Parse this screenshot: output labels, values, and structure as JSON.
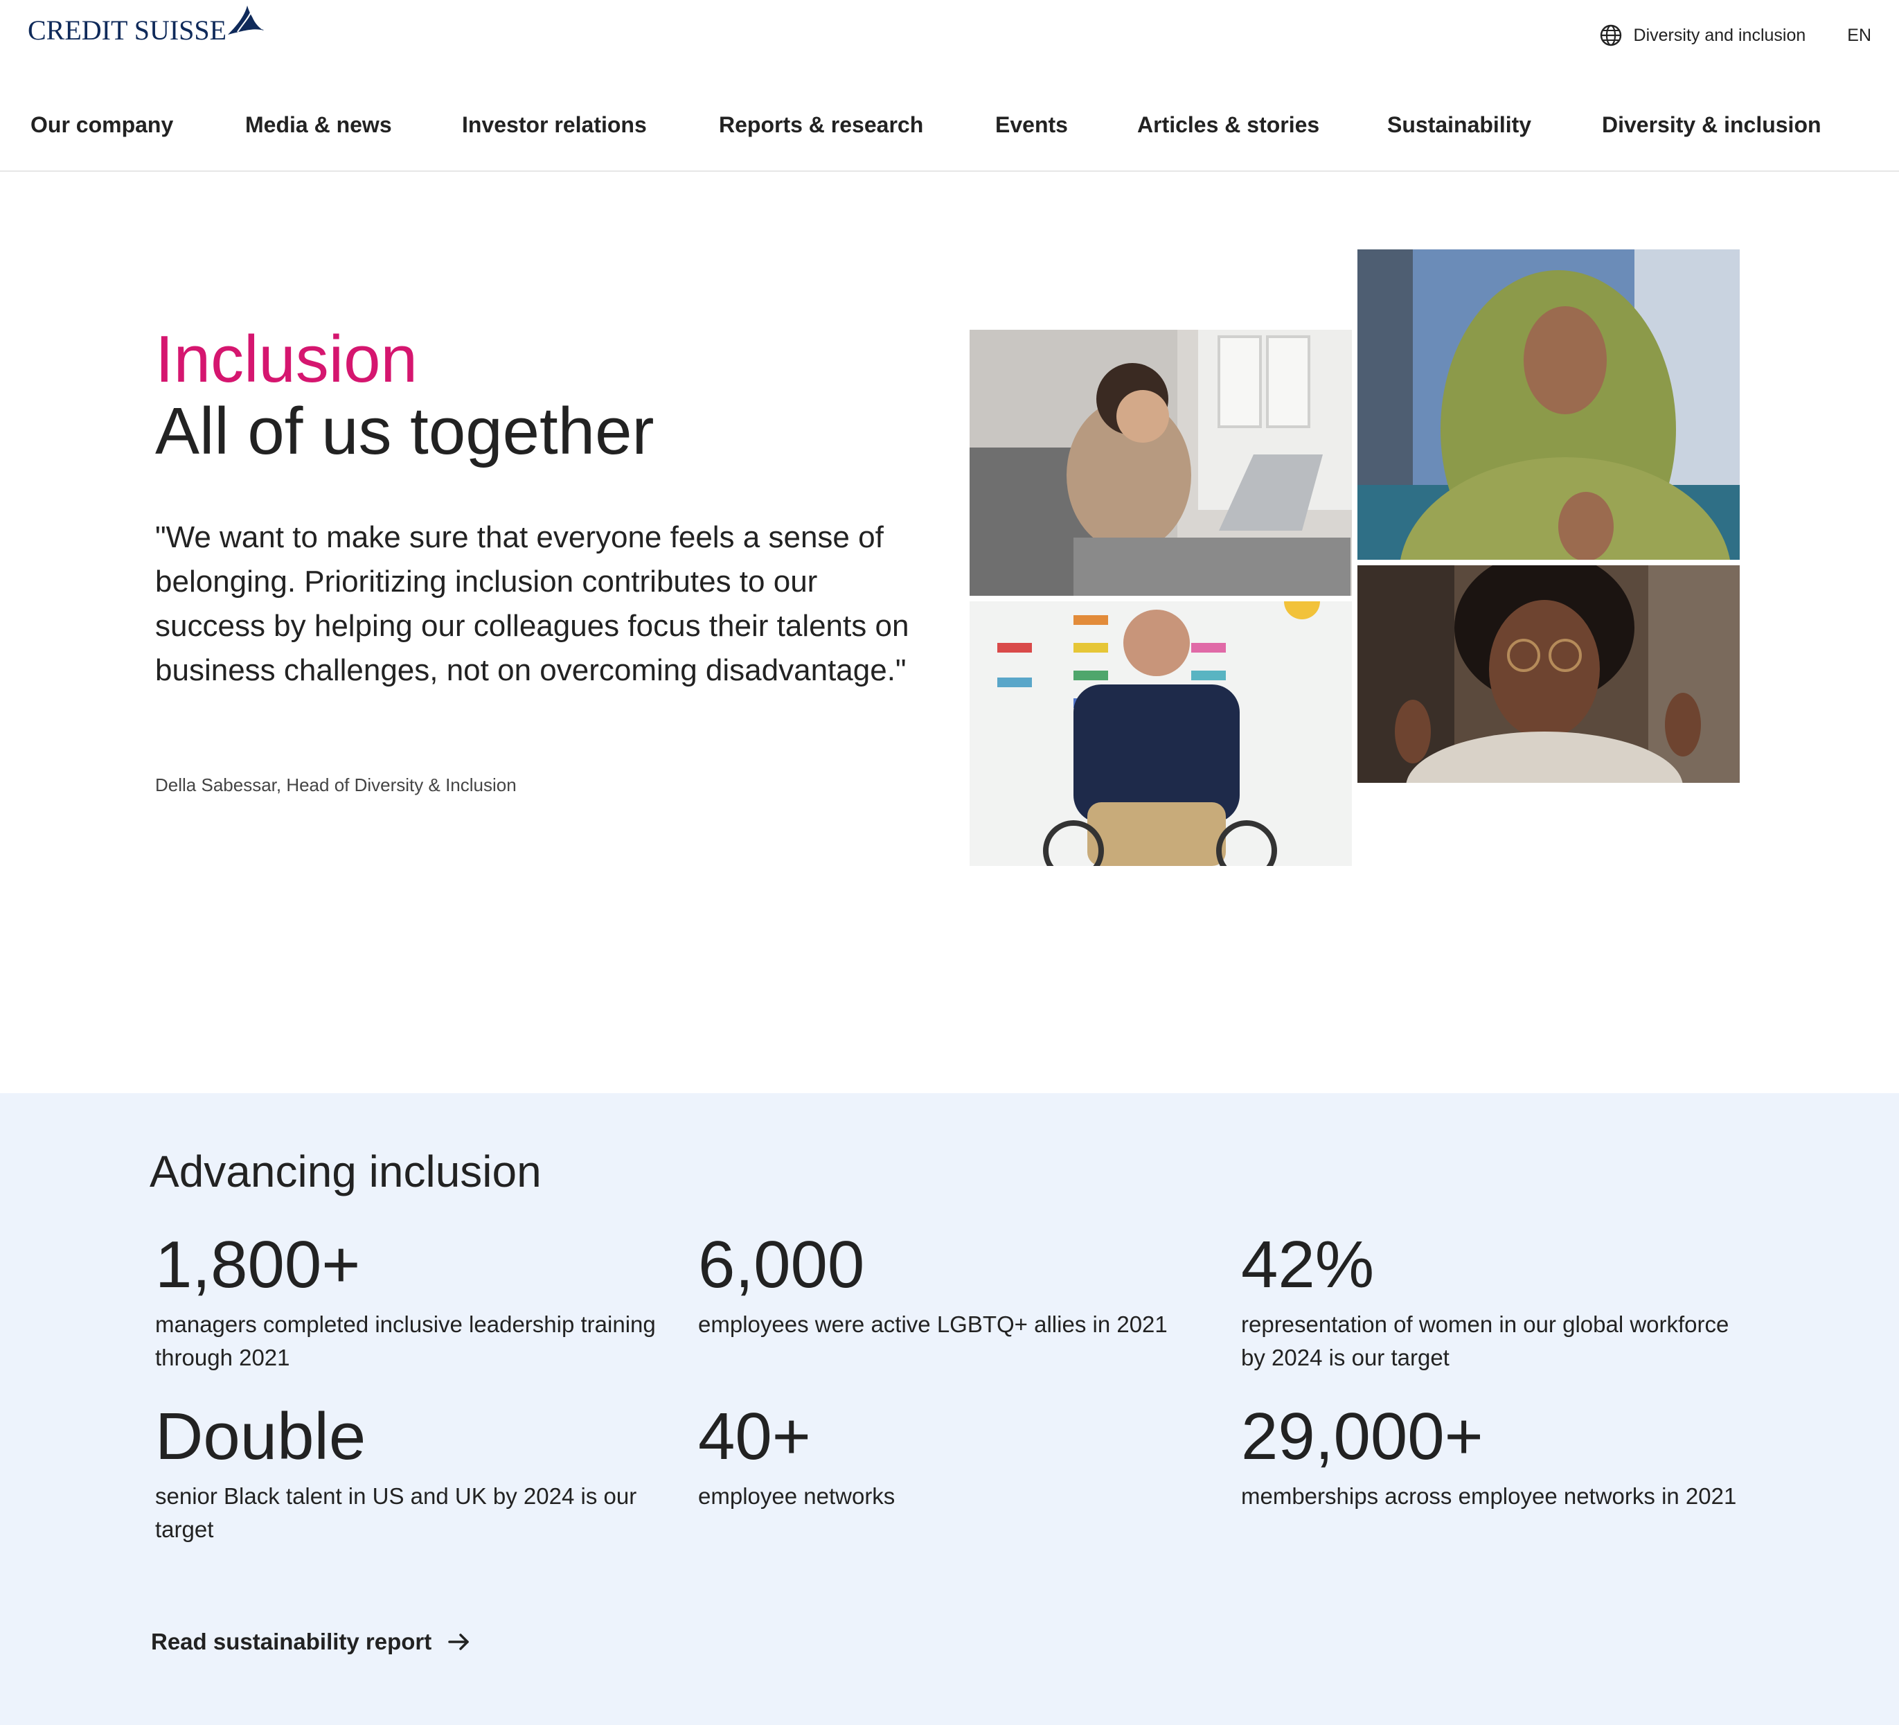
{
  "header": {
    "logo_text": "CREDIT SUISSE",
    "utility": {
      "globe_icon": "globe-icon",
      "section_link": "Diversity and inclusion",
      "language": "EN"
    },
    "nav": [
      {
        "label": "Our company"
      },
      {
        "label": "Media & news"
      },
      {
        "label": "Investor relations"
      },
      {
        "label": "Reports & research"
      },
      {
        "label": "Events"
      },
      {
        "label": "Articles & stories"
      },
      {
        "label": "Sustainability"
      },
      {
        "label": "Diversity & inclusion"
      }
    ]
  },
  "hero": {
    "kicker": "Inclusion",
    "title": "All of us together",
    "quote": "\"We want to make sure that everyone feels a sense of belonging. Prioritizing inclusion contributes to our success by helping our colleagues focus their talents on business challenges, not on overcoming disadvantage.\"",
    "attribution": "Della Sabessar, Head of Diversity & Inclusion"
  },
  "stats": {
    "title": "Advancing inclusion",
    "items": [
      {
        "number": "1,800+",
        "description": "managers completed inclusive leadership training through 2021"
      },
      {
        "number": "6,000",
        "description": "employees were active LGBTQ+ allies in 2021"
      },
      {
        "number": "42%",
        "description": "representation of women in our global workforce by 2024 is our target"
      },
      {
        "number": "Double",
        "description": "senior Black talent in US and UK by 2024 is our target"
      },
      {
        "number": "40+",
        "description": "employee networks"
      },
      {
        "number": "29,000+",
        "description": "memberships across employee networks in 2021"
      }
    ],
    "link_label": "Read sustainability report",
    "link_icon": "arrow-right-icon"
  },
  "colors": {
    "accent_pink": "#d5166f",
    "brand_navy": "#0f2a5a",
    "stats_background": "#edf3fc",
    "text": "#222222"
  }
}
